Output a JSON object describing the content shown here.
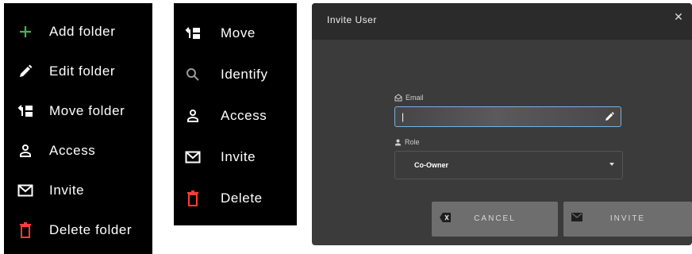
{
  "menu_folder": {
    "items": [
      {
        "label": "Add folder",
        "icon": "plus-icon",
        "color": "#4caf50"
      },
      {
        "label": "Edit folder",
        "icon": "pencil-icon",
        "color": "#ffffff"
      },
      {
        "label": "Move folder",
        "icon": "move-icon",
        "color": "#ffffff"
      },
      {
        "label": "Access",
        "icon": "person-icon",
        "color": "#ffffff"
      },
      {
        "label": "Invite",
        "icon": "envelope-icon",
        "color": "#ffffff"
      },
      {
        "label": "Delete folder",
        "icon": "trash-icon",
        "color": "#ff3b3b"
      }
    ]
  },
  "menu_item": {
    "items": [
      {
        "label": "Move",
        "icon": "move-icon",
        "color": "#ffffff"
      },
      {
        "label": "Identify",
        "icon": "search-icon",
        "color": "#9a9a9a"
      },
      {
        "label": "Access",
        "icon": "person-icon",
        "color": "#ffffff"
      },
      {
        "label": "Invite",
        "icon": "envelope-icon",
        "color": "#ffffff"
      },
      {
        "label": "Delete",
        "icon": "trash-icon",
        "color": "#ff3b3b"
      }
    ]
  },
  "dialog": {
    "title": "Invite User",
    "close_icon": "close-icon",
    "email_label": "Email",
    "email_value": "|",
    "role_label": "Role",
    "role_value": "Co-Owner",
    "cancel_label": "CANCEL",
    "invite_label": "INVITE",
    "accent": "#7ab0e0"
  }
}
